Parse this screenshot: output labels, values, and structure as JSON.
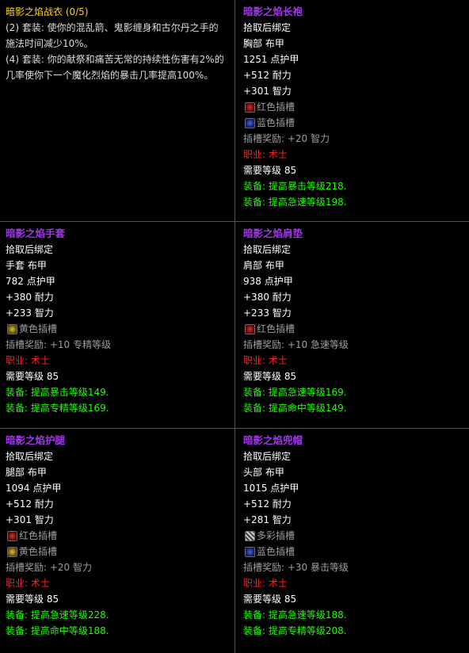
{
  "set_panel": {
    "title": "暗影之焰战衣 (0/5)",
    "bonus2_line1": "(2) 套装: 使你的混乱箭、鬼影缠身和古尔丹之手的",
    "bonus2_line2": "施法时间减少10%。",
    "bonus4_line1": "(4) 套装: 你的献祭和痛苦无常的持续性伤害有2%的",
    "bonus4_line2": "几率使你下一个魔化烈焰的暴击几率提高100%。"
  },
  "items": [
    {
      "name": "暗影之焰长袍",
      "bind": "拾取后绑定",
      "slot": "胸部 布甲",
      "armor": "1251 点护甲",
      "stat1": "+512 耐力",
      "stat2": "+301 智力",
      "socket1": "红色插槽",
      "socket2": "蓝色插槽",
      "socket_bonus": "插槽奖励: +20 智力",
      "class_label": "职业: 术士",
      "level": "需要等级 85",
      "equip1": "装备: 提高暴击等级218.",
      "equip2": "装备: 提高急速等级198."
    },
    {
      "name": "暗影之焰手套",
      "bind": "拾取后绑定",
      "slot": "手套 布甲",
      "armor": "782 点护甲",
      "stat1": "+380 耐力",
      "stat2": "+233 智力",
      "socket1": "黄色插槽",
      "socket_bonus": "插槽奖励: +10 专精等级",
      "class_label": "职业: 术士",
      "level": "需要等级 85",
      "equip1": "装备: 提高暴击等级149.",
      "equip2": "装备: 提高专精等级169."
    },
    {
      "name": "暗影之焰肩垫",
      "bind": "拾取后绑定",
      "slot": "肩部 布甲",
      "armor": "938 点护甲",
      "stat1": "+380 耐力",
      "stat2": "+233 智力",
      "socket1": "红色插槽",
      "socket_bonus": "插槽奖励: +10 急速等级",
      "class_label": "职业: 术士",
      "level": "需要等级 85",
      "equip1": "装备: 提高急速等级169.",
      "equip2": "装备: 提高命中等级149."
    },
    {
      "name": "暗影之焰护腿",
      "bind": "拾取后绑定",
      "slot": "腿部 布甲",
      "armor": "1094 点护甲",
      "stat1": "+512 耐力",
      "stat2": "+301 智力",
      "socket1": "红色插槽",
      "socket2": "黄色插槽",
      "socket_bonus": "插槽奖励: +20 智力",
      "class_label": "职业: 术士",
      "level": "需要等级 85",
      "equip1": "装备: 提高急速等级228.",
      "equip2": "装备: 提高命中等级188."
    },
    {
      "name": "暗影之焰兜帽",
      "bind": "拾取后绑定",
      "slot": "头部 布甲",
      "armor": "1015 点护甲",
      "stat1": "+512 耐力",
      "stat2": "+281 智力",
      "socket1": "多彩插槽",
      "socket2": "蓝色插槽",
      "socket_bonus": "插槽奖励: +30 暴击等级",
      "class_label": "职业: 术士",
      "level": "需要等级 85",
      "equip1": "装备: 提高急速等级188.",
      "equip2": "装备: 提高专精等级208."
    }
  ],
  "colors": {
    "epic_purple": "#a335ee",
    "set_yellow": "#ffd100",
    "class_red": "#ff2020",
    "equip_green": "#1eff00"
  }
}
